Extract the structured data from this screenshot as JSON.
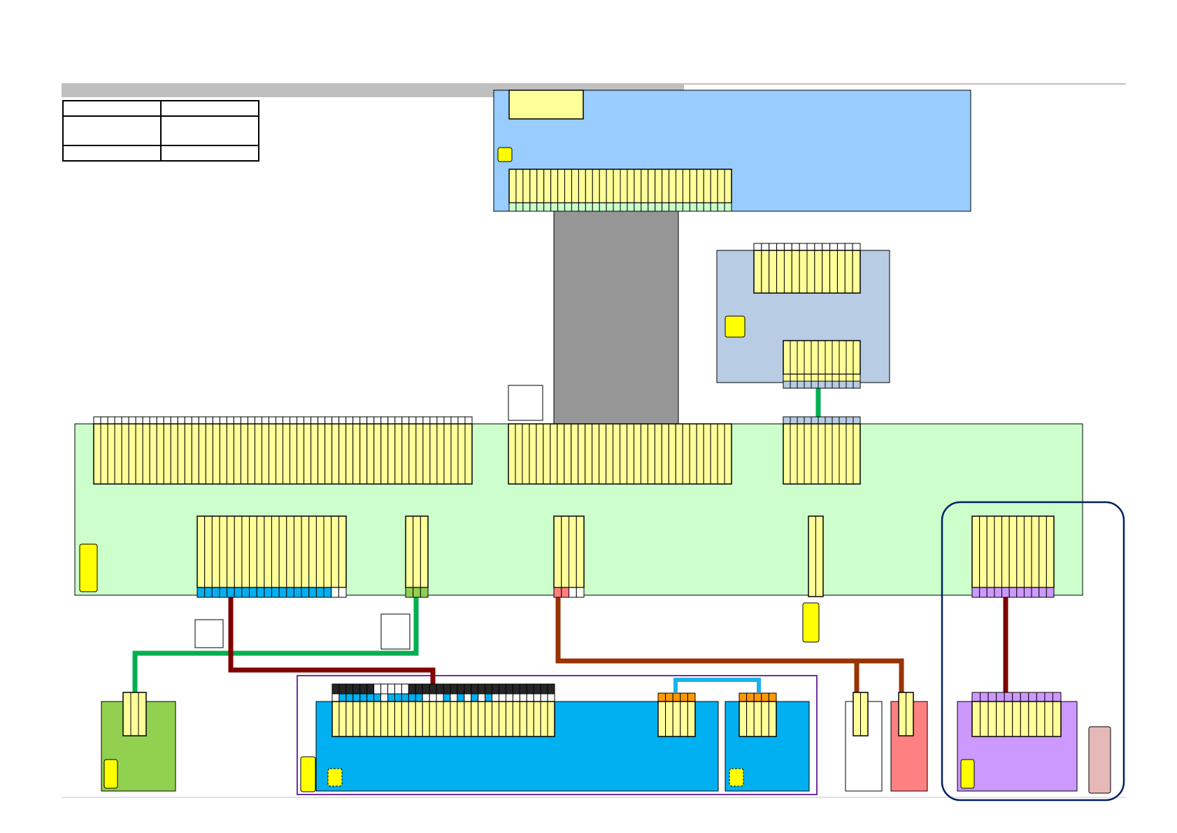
{
  "colors": {
    "header_bar": "#bfbfbf",
    "top_board": "#99ccff",
    "small_board": "#b8cce4",
    "main_board": "#ccffcc",
    "connector_pin": "#ffff99",
    "mount_tab": "#ffff00",
    "ribbon_cable": "#969696",
    "green_board": "#92d050",
    "blue_board": "#00b0f0",
    "salmon_board": "#ff8080",
    "purple_board": "#cc99ff",
    "side_tab": "#e6b8b7",
    "group_outline_navy": "#002060",
    "group_outline_purple": "#7030a0",
    "wire_green": "#00b050",
    "wire_darkred": "#800000",
    "wire_brown": "#993300",
    "wire_cyan": "#1ab2e8",
    "row_cyan": "#00b0f0",
    "row_lime": "#92d050",
    "row_pink": "#ff8080",
    "row_purple": "#cc99ff",
    "row_orange": "#ff9900",
    "row_black": "#262626"
  },
  "legend": {
    "rows": [
      [
        "",
        ""
      ],
      [
        "",
        ""
      ],
      [
        "",
        ""
      ]
    ]
  },
  "components": [
    {
      "id": "top-board",
      "kind": "board"
    },
    {
      "id": "ribbon-cable",
      "kind": "cable"
    },
    {
      "id": "small-board",
      "kind": "board"
    },
    {
      "id": "main-board",
      "kind": "board"
    },
    {
      "id": "green-board",
      "kind": "board"
    },
    {
      "id": "blue-board-left",
      "kind": "board"
    },
    {
      "id": "blue-board-right",
      "kind": "board"
    },
    {
      "id": "white-board",
      "kind": "board"
    },
    {
      "id": "salmon-board",
      "kind": "board"
    },
    {
      "id": "purple-board",
      "kind": "board"
    }
  ]
}
